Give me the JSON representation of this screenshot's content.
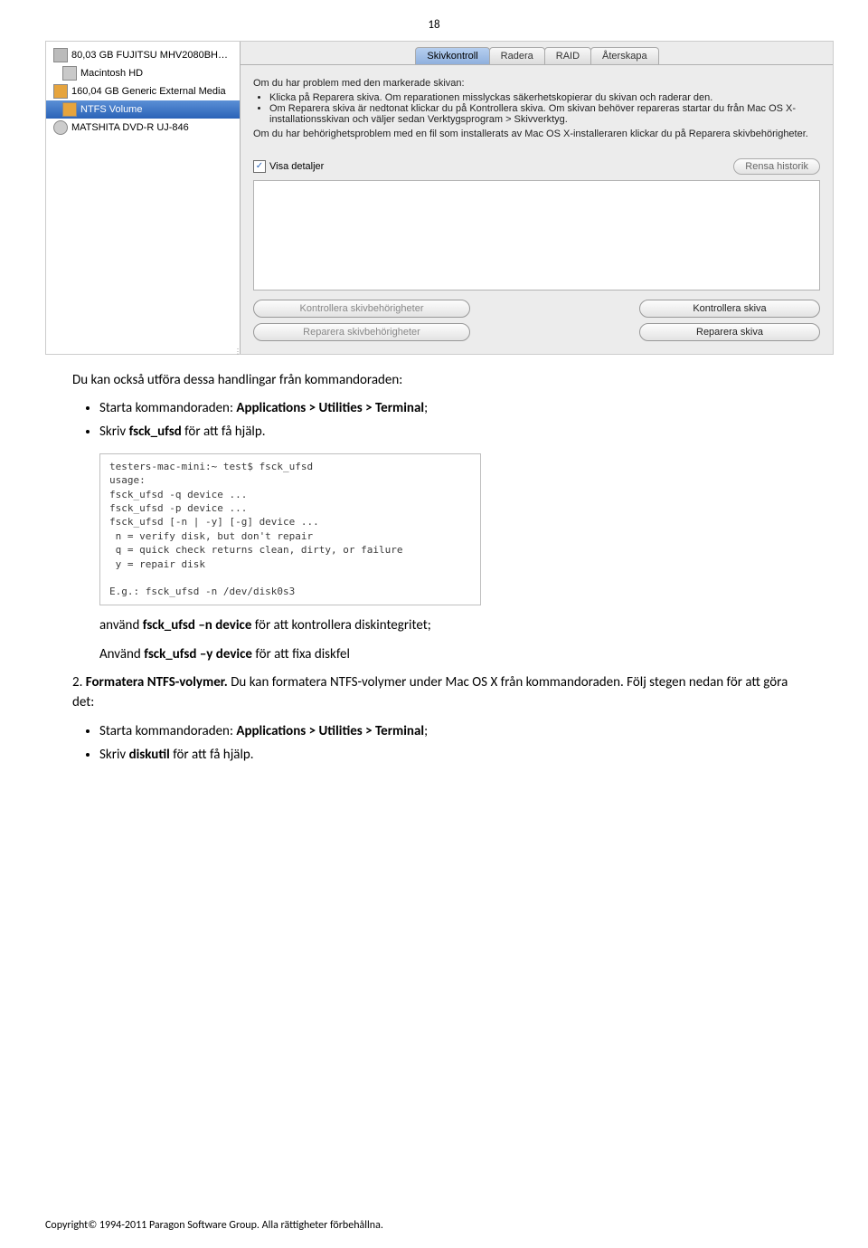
{
  "page_number": "18",
  "disk_utility": {
    "sidebar": {
      "items": [
        {
          "label": "80,03 GB FUJITSU MHV2080BH…",
          "icon": "disk"
        },
        {
          "label": "Macintosh HD",
          "icon": "hd",
          "indent": true
        },
        {
          "label": "160,04 GB Generic External Media",
          "icon": "ext"
        },
        {
          "label": "NTFS Volume",
          "icon": "ext",
          "indent": true,
          "selected": true
        },
        {
          "label": "MATSHITA DVD-R UJ-846",
          "icon": "opt"
        }
      ]
    },
    "tabs": [
      "Skivkontroll",
      "Radera",
      "RAID",
      "Återskapa"
    ],
    "active_tab": 0,
    "info_heading": "Om du har problem med den markerade skivan:",
    "info_bullets": [
      "Klicka på Reparera skiva. Om reparationen misslyckas säkerhetskopierar du skivan och raderar den.",
      "Om Reparera skiva är nedtonat klickar du på Kontrollera skiva. Om skivan behöver repareras startar du från Mac OS X-installationsskivan och väljer sedan Verktygsprogram > Skivverktyg."
    ],
    "info_perm": "Om du har behörighetsproblem med en fil som installerats av Mac OS X-installeraren klickar du på Reparera skivbehörigheter.",
    "show_details_label": "Visa detaljer",
    "clear_history_label": "Rensa historik",
    "buttons": {
      "verify_perm": "Kontrollera skivbehörigheter",
      "repair_perm": "Reparera skivbehörigheter",
      "verify_disk": "Kontrollera skiva",
      "repair_disk": "Reparera skiva"
    }
  },
  "doc": {
    "para1": "Du kan också utföra dessa handlingar från kommandoraden:",
    "bullets1": {
      "a_pre": "Starta kommandoraden: ",
      "a_bold": "Applications > Utilities > Terminal",
      "a_post": ";",
      "b_pre": "Skriv ",
      "b_bold": "fsck_ufsd",
      "b_post": " för att få hjälp."
    },
    "terminal": "testers-mac-mini:~ test$ fsck_ufsd\nusage:\nfsck_ufsd -q device ...\nfsck_ufsd -p device ...\nfsck_ufsd [-n | -y] [-g] device ...\n n = verify disk, but don't repair\n q = quick check returns clean, dirty, or failure\n y = repair disk\n\nE.g.: fsck_ufsd -n /dev/disk0s3",
    "after_terminal": {
      "a_pre": "använd ",
      "a_bold": "fsck_ufsd –n device",
      "a_post": " för att kontrollera diskintegritet;",
      "b_pre": "Använd ",
      "b_bold": "fsck_ufsd –y device",
      "b_post": " för att fixa diskfel"
    },
    "item2_pre": "2. ",
    "item2_bold": "Formatera NTFS-volymer.",
    "item2_post": " Du kan formatera NTFS-volymer under Mac OS X från kommandoraden. Följ stegen nedan för att göra det:",
    "bullets2": {
      "a_pre": "Starta kommandoraden: ",
      "a_bold": "Applications > Utilities > Terminal",
      "a_post": ";",
      "b_pre": "Skriv ",
      "b_bold": "diskutil",
      "b_post": " för att få hjälp."
    }
  },
  "copyright": "Copyright© 1994-2011 Paragon Software Group. Alla rättigheter förbehållna."
}
